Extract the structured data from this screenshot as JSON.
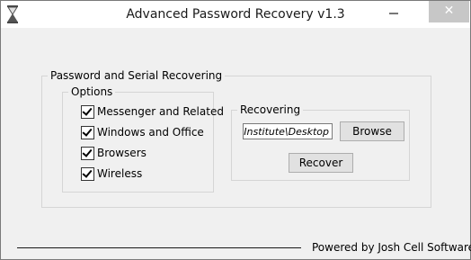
{
  "window": {
    "title": "Advanced Password Recovery v1.3"
  },
  "titlebar": {
    "close_glyph": "✕"
  },
  "main_group": {
    "legend": "Password and Serial Recovering"
  },
  "options": {
    "legend": "Options",
    "items": [
      {
        "label": "Messenger and Related",
        "checked": true
      },
      {
        "label": "Windows and Office",
        "checked": true
      },
      {
        "label": "Browsers",
        "checked": true
      },
      {
        "label": "Wireless",
        "checked": true
      }
    ]
  },
  "recovering": {
    "legend": "Recovering",
    "path_value": "ya Institute\\Desktop",
    "browse_label": "Browse",
    "recover_label": "Recover"
  },
  "footer": {
    "powered_by": "Powered by Josh Cell Softwares"
  }
}
